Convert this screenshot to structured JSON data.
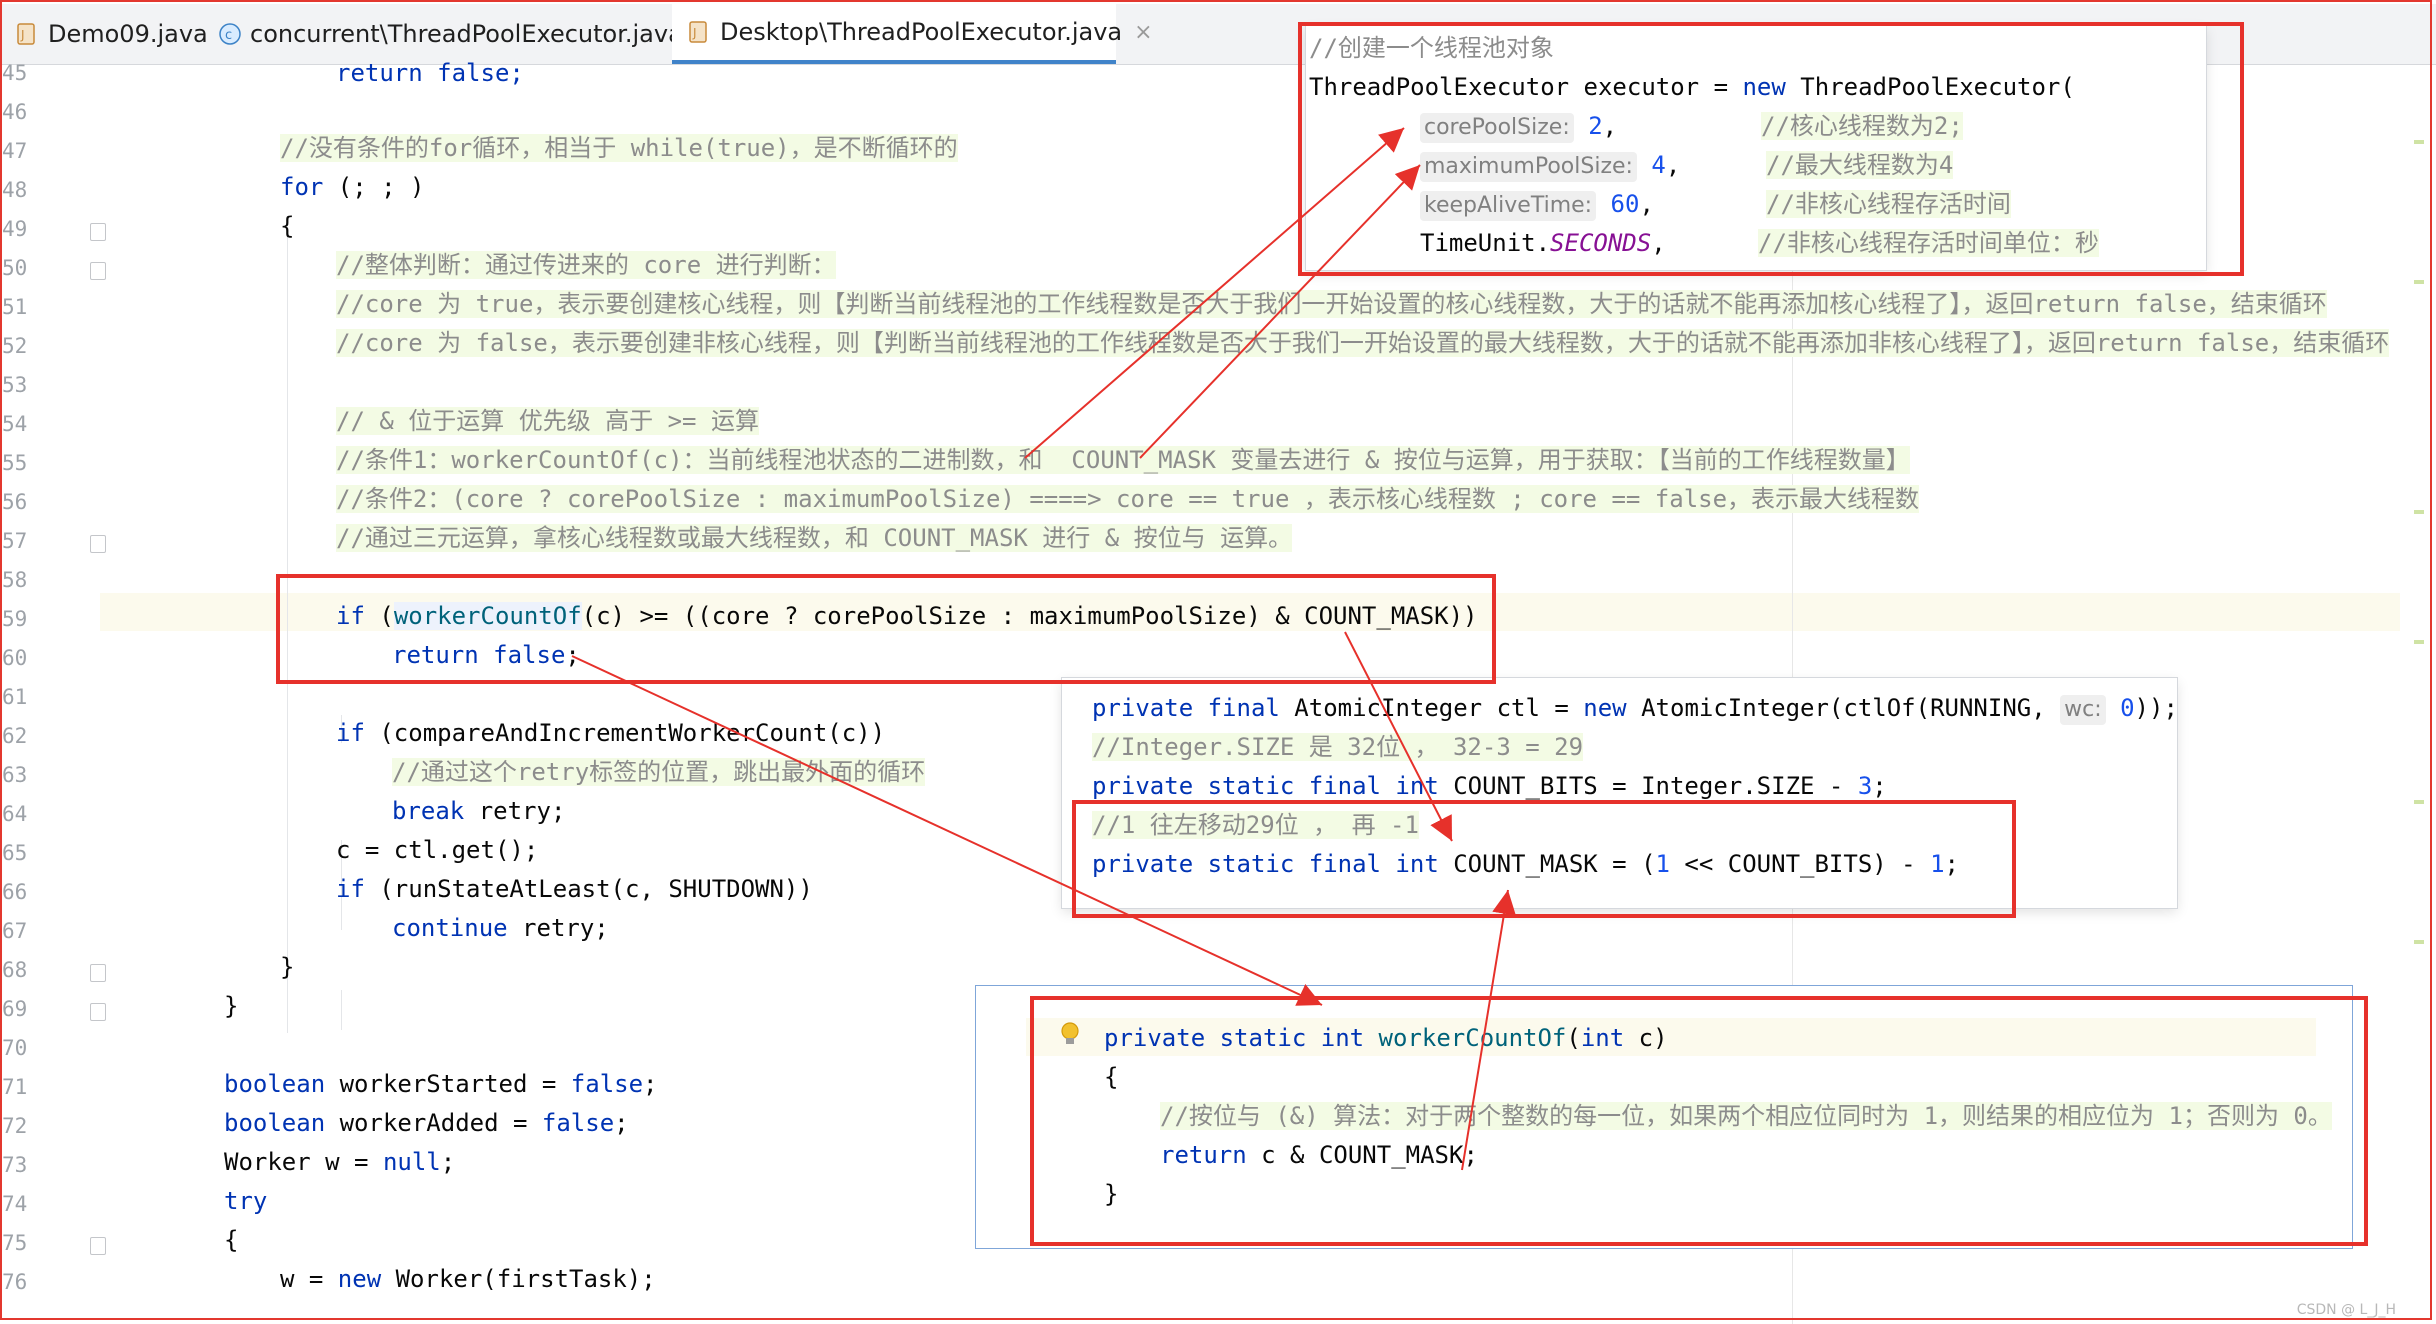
{
  "tabs": [
    {
      "label": "Demo09.java",
      "icon": "java-file-icon",
      "active": false
    },
    {
      "label": "concurrent\\ThreadPoolExecutor.java",
      "icon": "class-file-icon",
      "active": false
    },
    {
      "label": "Desktop\\ThreadPoolExecutor.java",
      "icon": "java-file-icon",
      "active": true
    }
  ],
  "close_glyph": "×",
  "line_numbers": [
    "45",
    "46",
    "47",
    "48",
    "49",
    "50",
    "51",
    "52",
    "53",
    "54",
    "55",
    "56",
    "57",
    "58",
    "59",
    "60",
    "61",
    "62",
    "63",
    "64",
    "65",
    "66",
    "67",
    "68",
    "69",
    "70",
    "71",
    "72",
    "73",
    "74",
    "75",
    "76"
  ],
  "code": {
    "l45_return": "return",
    "l45_false": " false;",
    "l47": "//没有条件的for循环，相当于 while(true)，是不断循环的",
    "l48_for": "for",
    "l48_rest": " (; ; )",
    "l49": "{",
    "l50": "//整体判断：通过传进来的 core 进行判断：",
    "l51": "//core 为 true，表示要创建核心线程，则【判断当前线程池的工作线程数是否大于我们一开始设置的核心线程数，大于的话就不能再添加核心线程了】，返回return false，结束循环",
    "l52": "//core 为 false，表示要创建非核心线程，则【判断当前线程池的工作线程数是否大于我们一开始设置的最大线程数，大于的话就不能再添加非核心线程了】，返回return false，结束循环",
    "l54": "// & 位于运算 优先级 高于 >= 运算",
    "l55": "//条件1：workerCountOf(c)：当前线程池状态的二进制数，和  COUNT_MASK 变量去进行 & 按位与运算，用于获取：【当前的工作线程数量】",
    "l56": "//条件2：(core ? corePoolSize : maximumPoolSize) ====> core == true ，表示核心线程数 ; core == false，表示最大线程数",
    "l57": "//通过三元运算，拿核心线程数或最大线程数，和 COUNT_MASK 进行 & 按位与 运算。",
    "l59_if": "if",
    "l59_open": " (",
    "l59_fn": "workerCountOf",
    "l59_rest": "(c) >= ((core ? corePoolSize : maximumPoolSize) & COUNT_MASK))",
    "l60_return": "return",
    "l60_false": " false",
    "l60_semi": ";",
    "l62_if": "if",
    "l62_rest": " (compareAndIncrementWorkerCount(c))",
    "l63": "//通过这个retry标签的位置，跳出最外面的循环",
    "l64_break": "break",
    "l64_rest": " retry;",
    "l65": "c = ctl.get();",
    "l66_if": "if",
    "l66_rest": " (runStateAtLeast(c, SHUTDOWN))",
    "l67_cont": "continue",
    "l67_rest": " retry;",
    "l68": "}",
    "l69": "}",
    "l71_bool": "boolean",
    "l71_mid": " workerStarted = ",
    "l71_false": "false",
    "l71_semi": ";",
    "l72_bool": "boolean",
    "l72_mid": " workerAdded = ",
    "l72_false": "false",
    "l72_semi": ";",
    "l73_mid": "Worker w = ",
    "l73_null": "null",
    "l73_semi": ";",
    "l74_try": "try",
    "l75": "{",
    "l76_pre": "w = ",
    "l76_new": "new",
    "l76_rest": " Worker(firstTask);"
  },
  "popup_executor": {
    "comment": "//创建一个线程池对象",
    "decl_pre": "ThreadPoolExecutor executor = ",
    "decl_new": "new",
    "decl_post": " ThreadPoolExecutor(",
    "hint_core": "corePoolSize:",
    "val_core": "2",
    "comma1": ",",
    "cmt_core": "//核心线程数为2;",
    "hint_max": "maximumPoolSize:",
    "val_max": "4",
    "comma2": ",",
    "cmt_max": "//最大线程数为4",
    "hint_keep": "keepAliveTime:",
    "val_keep": "60",
    "comma3": ",",
    "cmt_keep": "//非核心线程存活时间",
    "unit_pre": "TimeUnit.",
    "unit_const": "SECONDS",
    "comma4": ",",
    "cmt_unit": "//非核心线程存活时间单位：秒"
  },
  "popup_ctl": {
    "l1_kw": "private final",
    "l1_mid": " AtomicInteger ctl = ",
    "l1_new": "new",
    "l1_post": " AtomicInteger(ctlOf(RUNNING, ",
    "l1_hint": "wc:",
    "l1_val": "0",
    "l1_end": "));",
    "l2": "//Integer.SIZE 是 32位 ， 32-3 = 29",
    "l3_kw": "private static final int",
    "l3_mid": " COUNT_BITS = Integer.SIZE - ",
    "l3_val": "3",
    "l3_end": ";",
    "l4": "//1 往左移动29位 ， 再 -1",
    "l5_kw": "private static final int",
    "l5_mid": " COUNT_MASK = (",
    "l5_one": "1",
    "l5_mid2": " << COUNT_BITS) - ",
    "l5_one2": "1",
    "l5_end": ";"
  },
  "popup_worker": {
    "l1_kw": "private static int",
    "l1_fn": " workerCountOf",
    "l1_p": "(",
    "l1_int": "int",
    "l1_end": " c)",
    "l2": "{",
    "l3": "//按位与 (&) 算法：对于两个整数的每一位，如果两个相应位同时为 1，则结果的相应位为 1；否则为 0。",
    "l4_return": "return",
    "l4_rest": " c & COUNT_MASK;",
    "l5": "}"
  },
  "watermark": "CSDN @ L_J_H",
  "colors": {
    "annotation_red": "#e6312b",
    "keyword": "#0033b3",
    "comment_bg": "#f3fbe4",
    "active_tab": "#4083c9"
  }
}
